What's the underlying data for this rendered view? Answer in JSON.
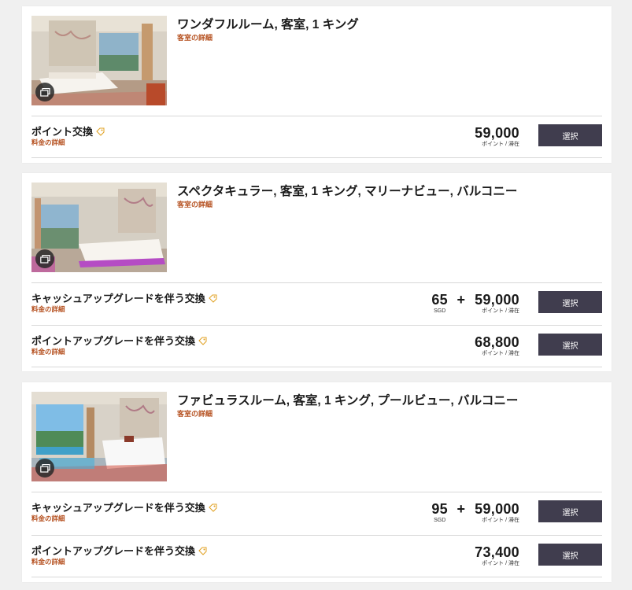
{
  "rooms": [
    {
      "title": "ワンダフルルーム, 客室, 1 キング",
      "detail_link": "客室の詳細",
      "rates": [
        {
          "name": "ポイント交換",
          "detail_link": "料金の詳細",
          "points": "59,000",
          "points_unit": "ポイント / 滞在",
          "select_label": "選択"
        }
      ]
    },
    {
      "title": "スペクタキュラー, 客室, 1 キング, マリーナビュー, バルコニー",
      "detail_link": "客室の詳細",
      "rates": [
        {
          "name": "キャッシュアップグレードを伴う交換",
          "detail_link": "料金の詳細",
          "cash": "65",
          "cash_unit": "SGD",
          "plus": "+",
          "points": "59,000",
          "points_unit": "ポイント / 滞在",
          "select_label": "選択"
        },
        {
          "name": "ポイントアップグレードを伴う交換",
          "detail_link": "料金の詳細",
          "points": "68,800",
          "points_unit": "ポイント / 滞在",
          "select_label": "選択"
        }
      ]
    },
    {
      "title": "ファビュラスルーム, 客室, 1 キング, プールビュー, バルコニー",
      "detail_link": "客室の詳細",
      "rates": [
        {
          "name": "キャッシュアップグレードを伴う交換",
          "detail_link": "料金の詳細",
          "cash": "95",
          "cash_unit": "SGD",
          "plus": "+",
          "points": "59,000",
          "points_unit": "ポイント / 滞在",
          "select_label": "選択"
        },
        {
          "name": "ポイントアップグレードを伴う交換",
          "detail_link": "料金の詳細",
          "points": "73,400",
          "points_unit": "ポイント / 滞在",
          "select_label": "選択"
        }
      ]
    }
  ],
  "icons": {
    "gallery": "gallery-icon",
    "tag": "tag-icon"
  },
  "colors": {
    "accent": "#b5501f",
    "button": "#403d4e",
    "background": "#f0f0f0"
  }
}
